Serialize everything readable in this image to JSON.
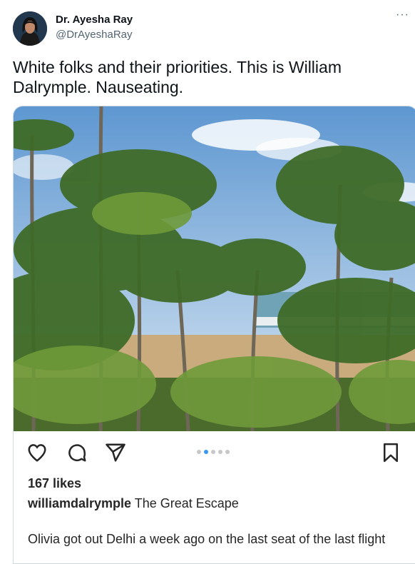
{
  "author": {
    "name": "Dr. Ayesha Ray",
    "handle": "@DrAyeshaRay"
  },
  "more_menu": "···",
  "tweet": {
    "text": "White folks and their priorities. This is William Dalrymple. Nauseating."
  },
  "instagram_post": {
    "actions": [
      "heart-icon",
      "comment-icon",
      "share-icon",
      "bookmark-icon"
    ],
    "carousel": {
      "total": 5,
      "active": 2
    },
    "likes": "167 likes",
    "username": "williamdalrymple",
    "caption": " The Great Escape",
    "body": "Olivia got out Delhi a week ago on the last seat of the last flight"
  },
  "colors": {
    "text_primary": "#0f1419",
    "text_secondary": "#536471",
    "carousel_active": "#3897f0"
  }
}
